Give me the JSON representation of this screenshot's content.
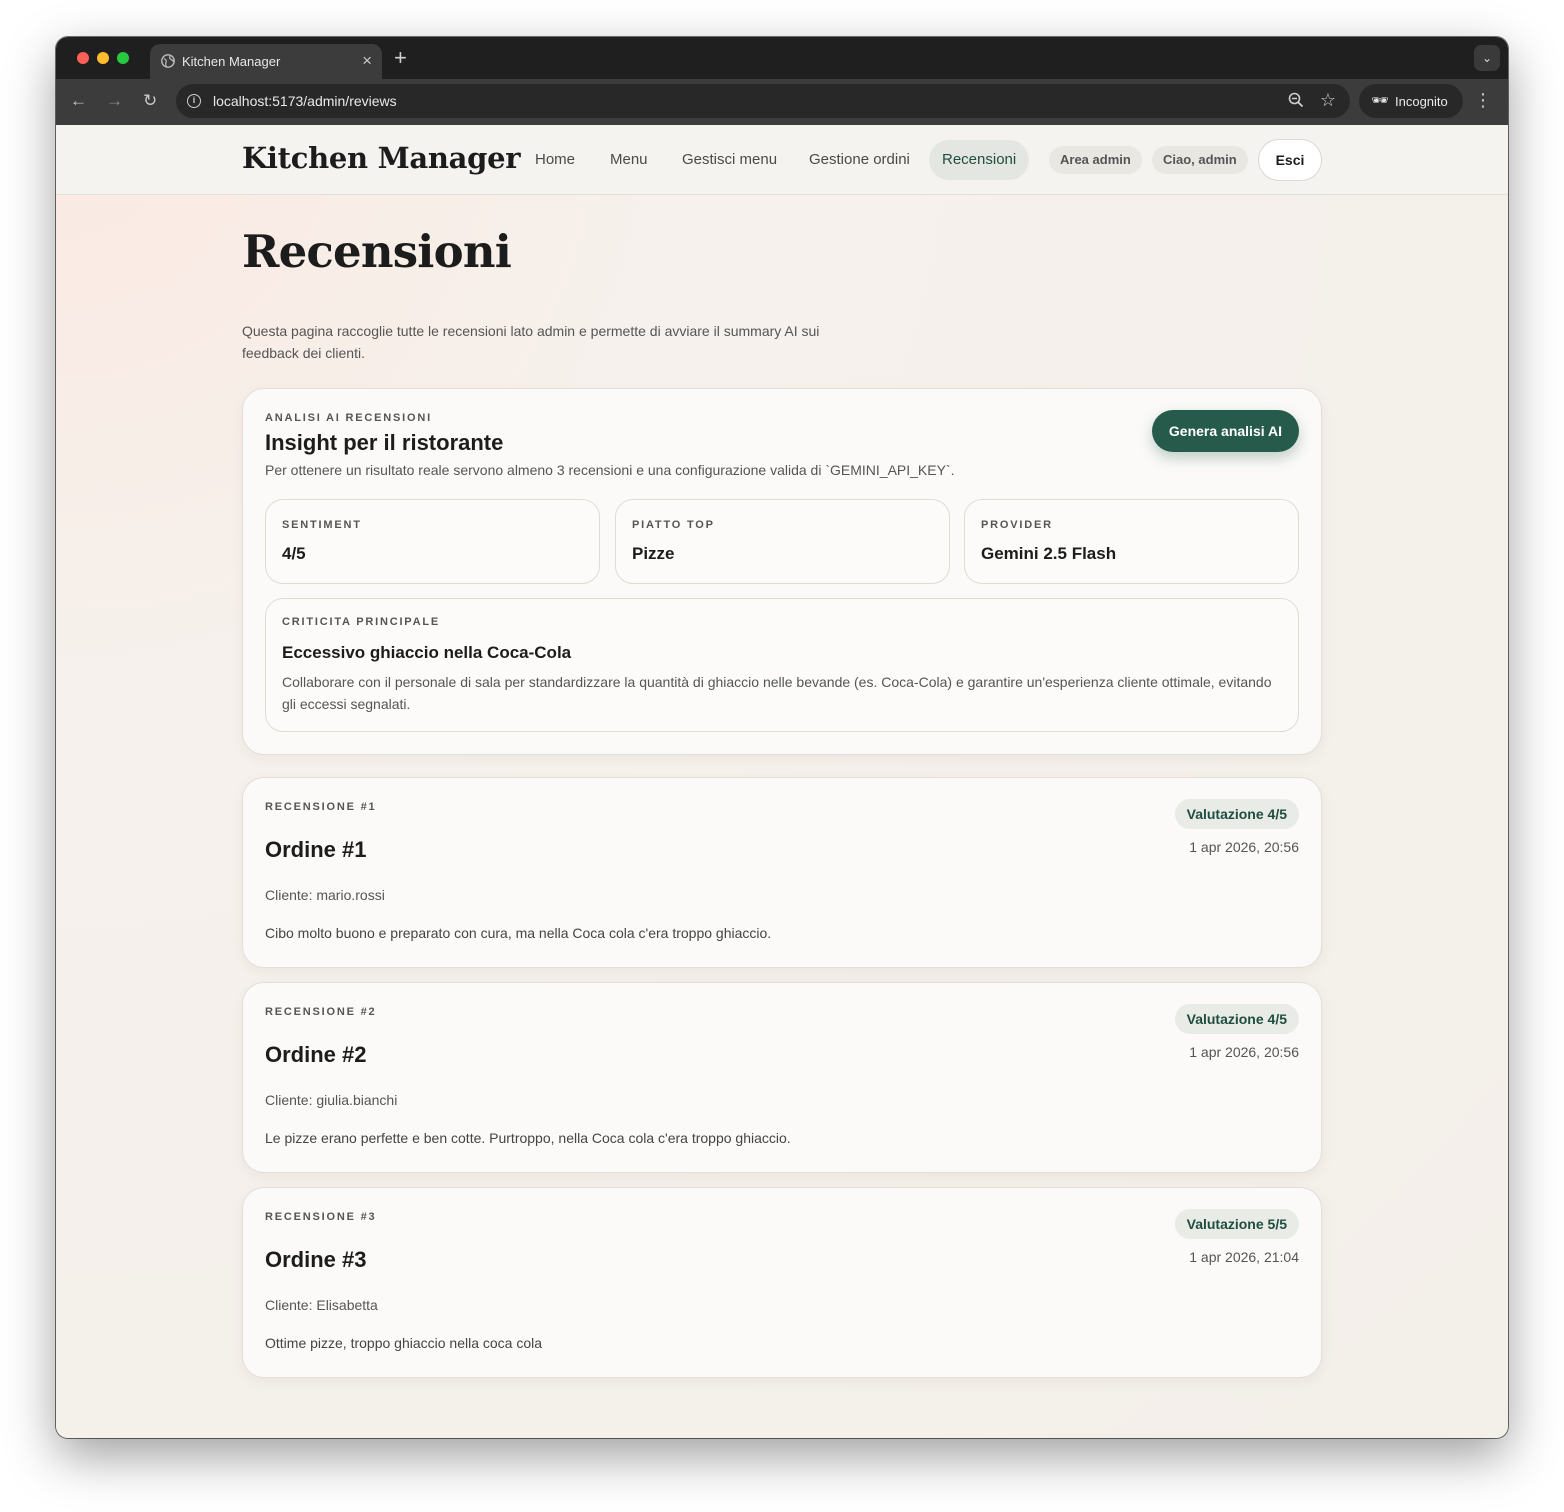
{
  "browser": {
    "tab_title": "Kitchen Manager",
    "url": "localhost:5173/admin/reviews",
    "incognito_label": "Incognito"
  },
  "site": {
    "brand": "Kitchen Manager",
    "nav": [
      {
        "label": "Home",
        "active": false
      },
      {
        "label": "Menu",
        "active": false
      },
      {
        "label": "Gestisci menu",
        "active": false
      },
      {
        "label": "Gestione ordini",
        "active": false
      },
      {
        "label": "Recensioni",
        "active": true
      }
    ],
    "admin_pill": "Area admin",
    "user_pill": "Ciao, admin",
    "logout_label": "Esci"
  },
  "page": {
    "title": "Recensioni",
    "subtitle": "Questa pagina raccoglie tutte le recensioni lato admin e permette di avviare il summary AI sui feedback dei clienti."
  },
  "ai": {
    "eyebrow": "Analisi AI recensioni",
    "title": "Insight per il ristorante",
    "description": "Per ottenere un risultato reale servono almeno 3 recensioni e una configurazione valida di `GEMINI_API_KEY`.",
    "button_label": "Genera analisi AI",
    "stats": [
      {
        "label": "Sentiment",
        "value": "4/5"
      },
      {
        "label": "Piatto top",
        "value": "Pizze"
      },
      {
        "label": "Provider",
        "value": "Gemini 2.5 Flash"
      }
    ],
    "issue": {
      "label": "Criticita principale",
      "title": "Eccessivo ghiaccio nella Coca-Cola",
      "text": "Collaborare con il personale di sala per standardizzare la quantità di ghiaccio nelle bevande (es. Coca-Cola) e garantire un'esperienza cliente ottimale, evitando gli eccessi segnalati."
    }
  },
  "reviews": [
    {
      "eyebrow": "Recensione #1",
      "order": "Ordine #1",
      "rating": "Valutazione 4/5",
      "date": "1 apr 2026, 20:56",
      "client": "Cliente: mario.rossi",
      "text": "Cibo molto buono e preparato con cura, ma nella Coca cola c'era troppo ghiaccio."
    },
    {
      "eyebrow": "Recensione #2",
      "order": "Ordine #2",
      "rating": "Valutazione 4/5",
      "date": "1 apr 2026, 20:56",
      "client": "Cliente: giulia.bianchi",
      "text": "Le pizze erano perfette e ben cotte. Purtroppo, nella Coca cola c'era troppo ghiaccio."
    },
    {
      "eyebrow": "Recensione #3",
      "order": "Ordine #3",
      "rating": "Valutazione 5/5",
      "date": "1 apr 2026, 21:04",
      "client": "Cliente: Elisabetta",
      "text": "Ottime pizze, troppo ghiaccio nella coca cola"
    }
  ]
}
